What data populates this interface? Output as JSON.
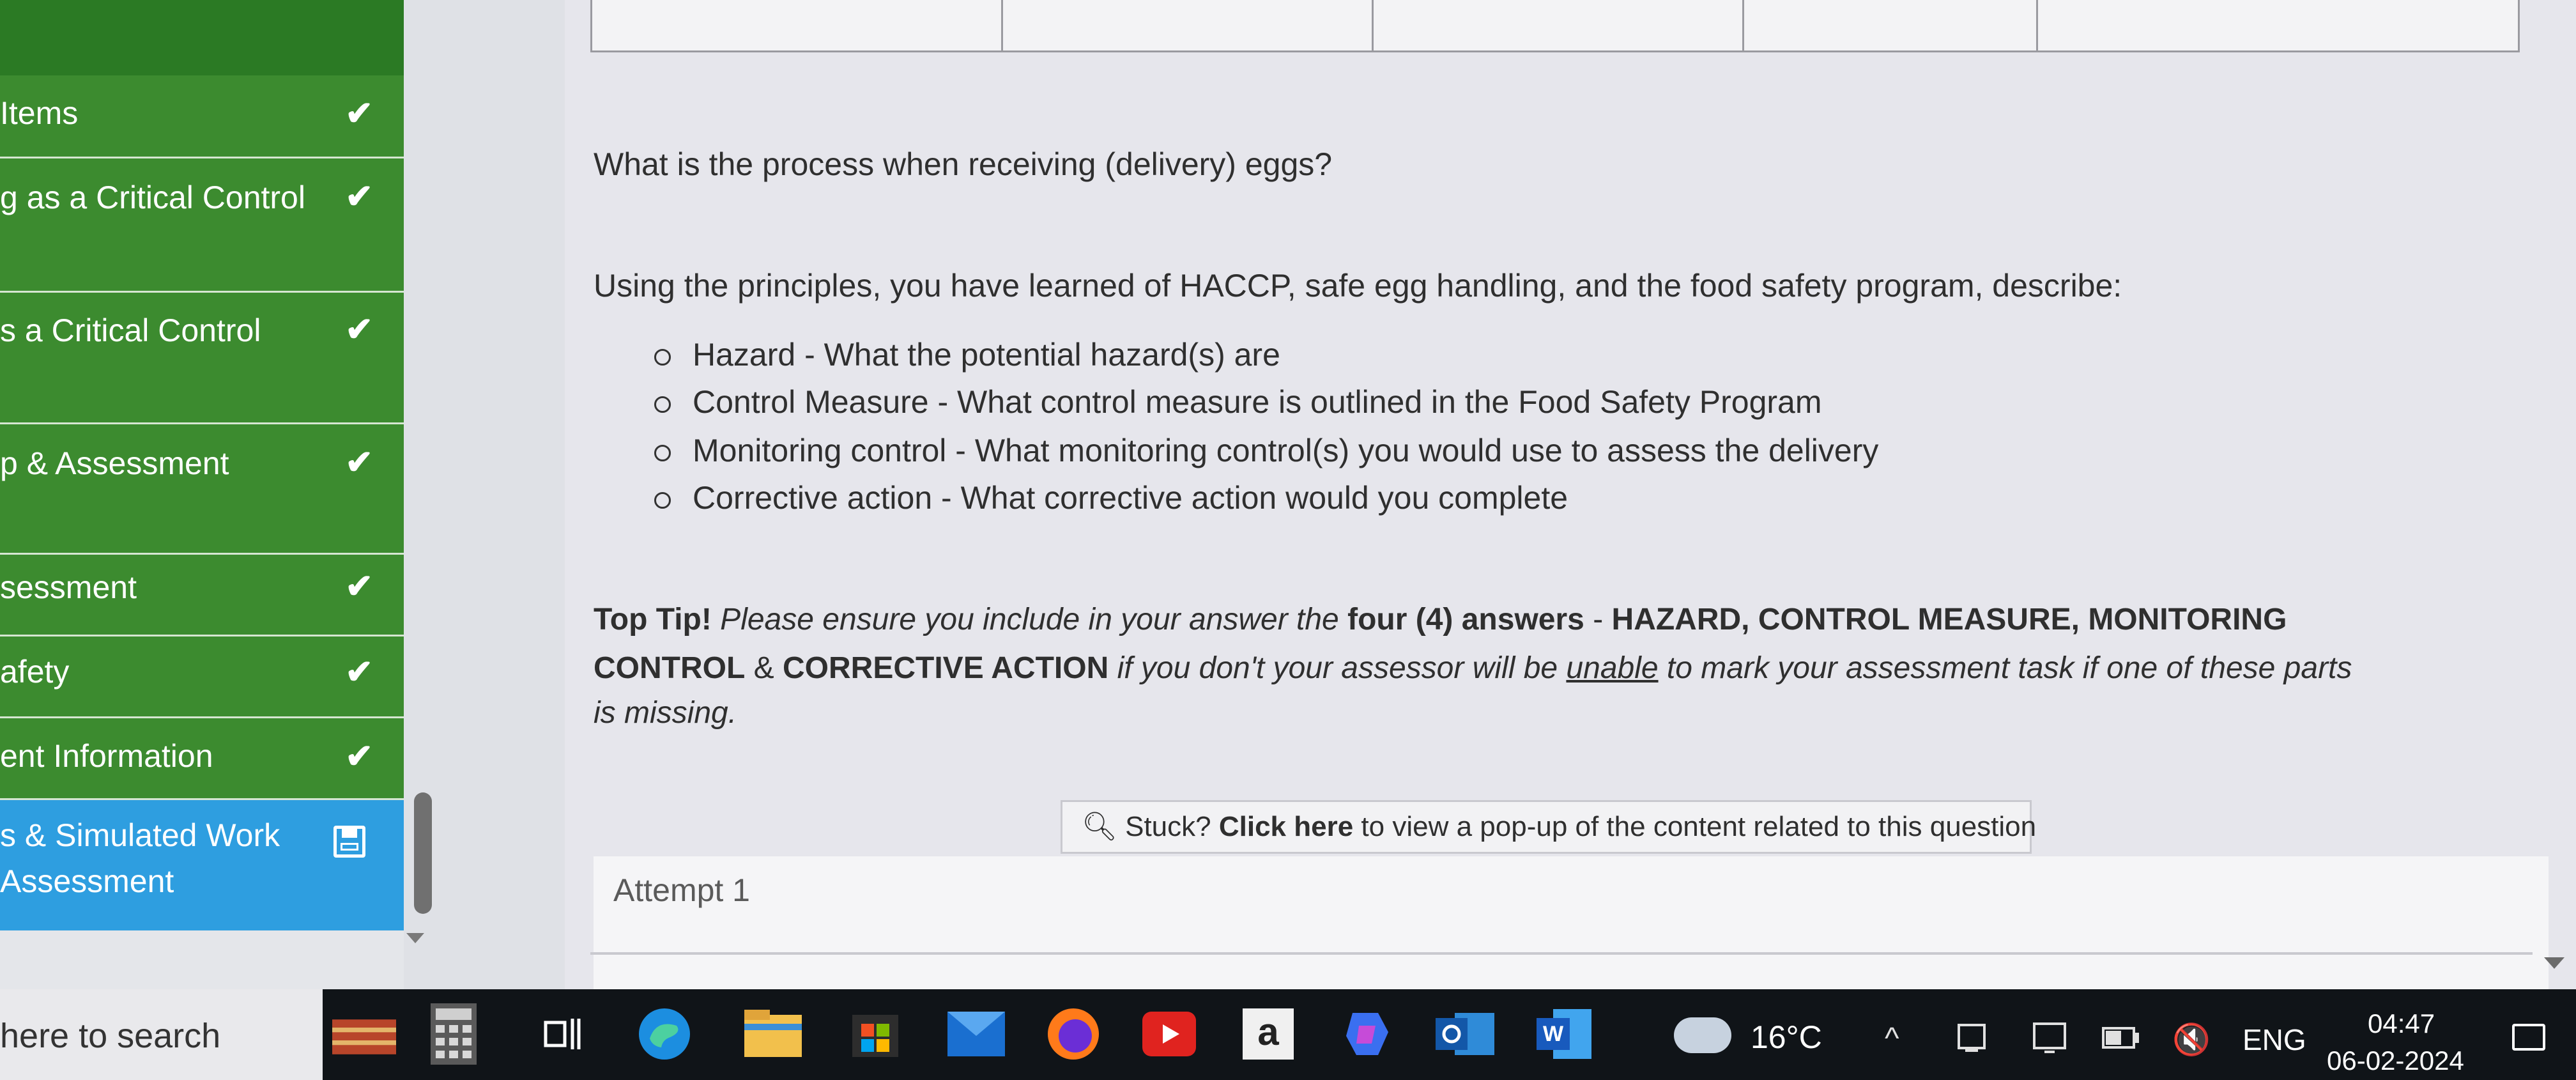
{
  "sidebar": {
    "items": [
      {
        "label": "Items",
        "status": "✔"
      },
      {
        "label": "g as a Critical Control",
        "status": "✔"
      },
      {
        "label": "s a Critical Control",
        "status": "✔"
      },
      {
        "label": "p & Assessment",
        "status": "✔"
      },
      {
        "label": "sessment",
        "status": "✔"
      },
      {
        "label": "afety",
        "status": "✔"
      },
      {
        "label": "ent Information",
        "status": "✔"
      },
      {
        "label_line1": "s & Simulated Work",
        "label_line2": "Assessment",
        "status_icon": "save-icon"
      }
    ]
  },
  "question": {
    "title": "What is the process when receiving (delivery) eggs?",
    "intro": "Using the principles, you have learned of HACCP, safe egg handling, and the food safety program, describe:",
    "bullets": [
      "Hazard - What the potential hazard(s) are",
      "Control Measure - What control measure is outlined in the Food Safety Program",
      "Monitoring control - What monitoring control(s) you would use to assess the delivery",
      "Corrective action - What corrective action would you complete"
    ],
    "tip": {
      "lead": "Top Tip!",
      "p1": "Please ensure you include in your answer the",
      "b1": "four (4) answers",
      "p2": "-",
      "b2": "HAZARD, CONTROL MEASURE, MONITORING",
      "b3": "CONTROL",
      "p3": "&",
      "b4": "CORRECTIVE ACTION",
      "p4": "if you don't your assessor will be",
      "u1": "unable",
      "p5": "to mark your assessment task if one of these parts",
      "p6": "is missing."
    }
  },
  "stuck": {
    "icon": "search-icon",
    "lead": "Stuck?",
    "link": "Click here",
    "rest": "to view a pop-up of the content related to this question"
  },
  "attempt": {
    "label": "Attempt 1"
  },
  "taskbar": {
    "search_placeholder": "here to search",
    "apps": [
      "books-icon",
      "calculator-icon",
      "task-view-icon",
      "edge-icon",
      "file-explorer-icon",
      "store-icon",
      "mail-icon",
      "firefox-icon",
      "youtube-icon",
      "amazon-icon",
      "copilot-icon",
      "outlook-icon",
      "word-icon"
    ],
    "amazon_label": "a",
    "temperature": "16°C",
    "tray": {
      "chevron": "^",
      "volume": "🔇",
      "language": "ENG"
    },
    "time": "04:47",
    "date": "06-02-2024"
  }
}
